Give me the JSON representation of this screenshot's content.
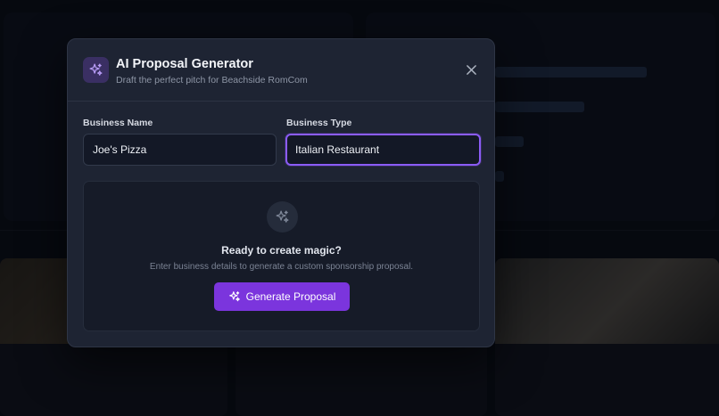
{
  "modal": {
    "title": "AI Proposal Generator",
    "subtitle": "Draft the perfect pitch for Beachside RomCom",
    "header_icon": "sparkles-icon",
    "close_icon": "close-icon"
  },
  "form": {
    "business_name": {
      "label": "Business Name",
      "value": "Joe's Pizza"
    },
    "business_type": {
      "label": "Business Type",
      "value": "Italian Restaurant"
    }
  },
  "empty_state": {
    "icon": "sparkles-icon",
    "title": "Ready to create magic?",
    "description": "Enter business details to generate a custom sponsorship proposal.",
    "button_label": "Generate Proposal"
  },
  "colors": {
    "accent": "#8b5cf6",
    "button": "#7b35dd",
    "modal_bg": "#1e2433"
  }
}
